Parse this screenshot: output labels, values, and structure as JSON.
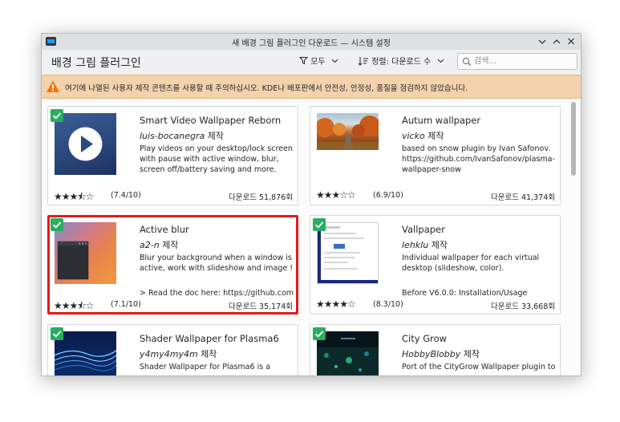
{
  "window": {
    "title": "새 배경 그림 플러그인 다운로드 — 시스템 설정"
  },
  "header": {
    "title": "배경 그림 플러그인",
    "filter_label": "모두",
    "sort_label": "정렬: 다운로드 수",
    "search_placeholder": "검색..."
  },
  "warning": {
    "text": "여기에 나열된 사용자 제작 콘텐츠를 사용할 때 주의하십시오. KDE나 배포판에서 안전성, 안정성, 품질을 점검하지 않았습니다."
  },
  "cards": [
    {
      "title": "Smart Video Wallpaper Reborn",
      "author": "luis-bocanegra",
      "author_suffix": "제작",
      "description": "Play videos on your desktop/lock screen with pause with active window, blur, screen off/battery saving and more.",
      "description2": "",
      "stars": "★★★⯪☆",
      "rating": "(7.4/10)",
      "downloads": "다운로드 51,876회"
    },
    {
      "title": "Autum wallpaper",
      "author": "vicko",
      "author_suffix": "제작",
      "description": "based on snow plugin by Ivan Safonov. https://github.com/IvanSafonov/plasma-wallpaper-snow",
      "description2": "",
      "stars": "★★★☆☆",
      "rating": "(6.9/10)",
      "downloads": "다운로드 41,374회"
    },
    {
      "title": "Active blur",
      "author": "a2-n",
      "author_suffix": "제작",
      "description": "Blur your background when a window is active, work with slideshow and image !",
      "description2": "> Read the doc here: https://github.com...",
      "stars": "★★★⯪☆",
      "rating": "(7.1/10)",
      "downloads": "다운로드 35,174회"
    },
    {
      "title": "Vallpaper",
      "author": "lehklu",
      "author_suffix": "제작",
      "description": "Individual wallpaper for each virtual desktop (slideshow, color).",
      "description2": "Before V6.0.0: Installation/Usage",
      "stars": "★★★★☆",
      "rating": "(8.3/10)",
      "downloads": "다운로드 33,668회"
    },
    {
      "title": "Shader Wallpaper for Plasma6",
      "author": "y4my4my4m",
      "author_suffix": "제작",
      "description": "Shader Wallpaper for Plasma6 is a",
      "description2": "",
      "stars": "",
      "rating": "",
      "downloads": ""
    },
    {
      "title": "City Grow",
      "author": "HobbyBlobby",
      "author_suffix": "제작",
      "description": "Port of the CityGrow Wallpaper plugin to",
      "description2": "",
      "stars": "",
      "rating": "",
      "downloads": ""
    }
  ],
  "colors": {
    "accent": "#1d99f3",
    "check": "#27ae60",
    "warning_bg": "#f3d2ad",
    "selection": "#e01b1b"
  }
}
